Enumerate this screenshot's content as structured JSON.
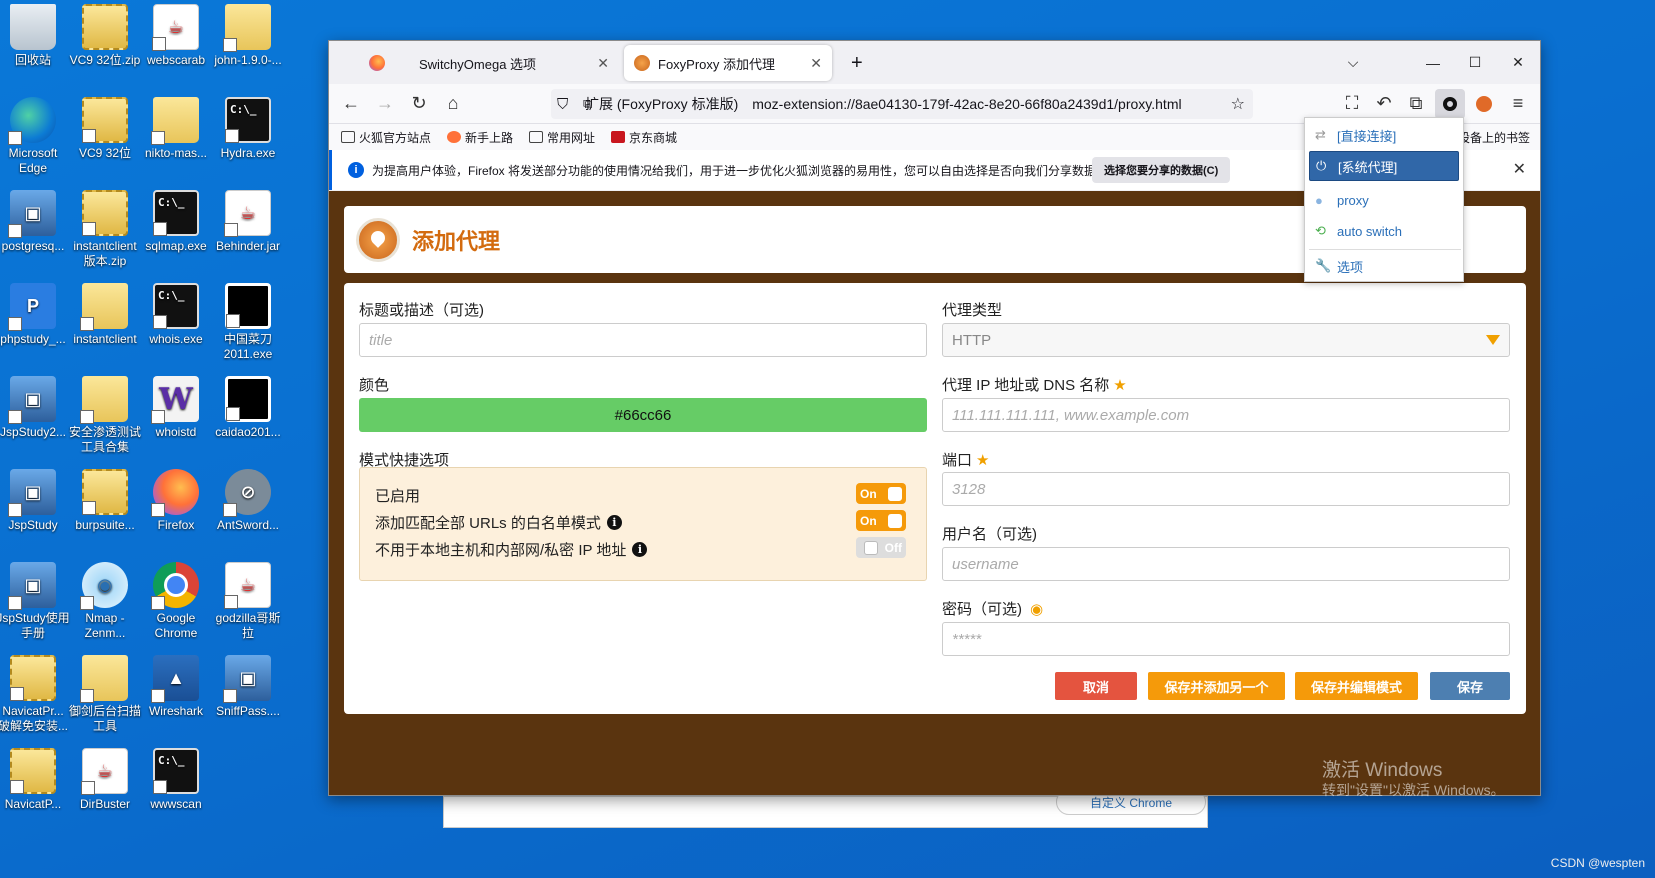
{
  "desktop": {
    "icons": [
      {
        "label": "回收站"
      },
      {
        "label": "VC9 32位.zip"
      },
      {
        "label": "webscarab"
      },
      {
        "label": "john-1.9.0-..."
      },
      {
        "label": "Microsoft Edge"
      },
      {
        "label": "VC9 32位"
      },
      {
        "label": "nikto-mas..."
      },
      {
        "label": "Hydra.exe"
      },
      {
        "label": "postgresq..."
      },
      {
        "label": "instantclient 版本.zip"
      },
      {
        "label": "sqlmap.exe"
      },
      {
        "label": "Behinder.jar"
      },
      {
        "label": "phpstudy_..."
      },
      {
        "label": "instantclient"
      },
      {
        "label": "whois.exe"
      },
      {
        "label": "中国菜刀2011.exe"
      },
      {
        "label": "JspStudy2..."
      },
      {
        "label": "安全渗透测试工具合集"
      },
      {
        "label": "whoistd"
      },
      {
        "label": "caidao201..."
      },
      {
        "label": "JspStudy"
      },
      {
        "label": "burpsuite..."
      },
      {
        "label": "Firefox"
      },
      {
        "label": "AntSword..."
      },
      {
        "label": "JspStudy使用手册"
      },
      {
        "label": "Nmap - Zenm..."
      },
      {
        "label": "Google Chrome"
      },
      {
        "label": "godzilla哥斯拉"
      },
      {
        "label": "NavicatPr... 破解免安装..."
      },
      {
        "label": "御剑后台扫描工具"
      },
      {
        "label": "Wireshark"
      },
      {
        "label": "SniffPass...."
      },
      {
        "label": "NavicatP..."
      },
      {
        "label": "DirBuster"
      },
      {
        "label": "wwwscan"
      }
    ],
    "watermark_line1": "激活 Windows",
    "watermark_line2": "转到\"设置\"以激活 Windows。",
    "csdn": "CSDN @wespten",
    "bg_window_button": "自定义 Chrome"
  },
  "browser": {
    "tabs": [
      {
        "label": "SwitchyOmega 选项"
      },
      {
        "label": "FoxyProxy 添加代理"
      }
    ],
    "new_tab": "+",
    "url_ext_label": "扩展 (FoxyProxy 标准版)",
    "url": "moz-extension://8ae04130-179f-42ac-8e20-66f80a2439d1/proxy.html",
    "bookmarks": [
      {
        "label": "火狐官方站点"
      },
      {
        "label": "新手上路"
      },
      {
        "label": "常用网址"
      },
      {
        "label": "京东商城"
      }
    ],
    "bookmarks_right": "设备上的书签",
    "notification": {
      "text": "为提高用户体验，Firefox 将发送部分功能的使用情况给我们，用于进一步优化火狐浏览器的易用性，您可以自由选择是否向我们分享数据。",
      "button": "选择您要分享的数据(C)"
    }
  },
  "foxyproxy": {
    "header_title": "添加代理",
    "title_label": "标题或描述（可选)",
    "title_placeholder": "title",
    "color_label": "颜色",
    "color_value": "#66cc66",
    "mode_label": "模式快捷选项",
    "mode_rows": [
      {
        "label": "已启用",
        "toggle": "On"
      },
      {
        "label": "添加匹配全部 URLs 的白名单模式",
        "toggle": "On"
      },
      {
        "label": "不用于本地主机和内部网/私密 IP 地址",
        "toggle": "Off"
      }
    ],
    "proxy_type_label": "代理类型",
    "proxy_type_value": "HTTP",
    "ip_label": "代理 IP 地址或 DNS 名称",
    "ip_placeholder": "111.111.111.111, www.example.com",
    "port_label": "端口",
    "port_placeholder": "3128",
    "user_label": "用户名（可选)",
    "user_placeholder": "username",
    "pass_label": "密码（可选)",
    "pass_placeholder": "*****",
    "buttons": {
      "cancel": "取消",
      "save_add": "保存并添加另一个",
      "save_edit": "保存并编辑模式",
      "save": "保存"
    },
    "brand_color": "#d36b0f",
    "bg_color": "#5a340f"
  },
  "switchy_menu": {
    "items": [
      {
        "label": "[直接连接]",
        "icon": "arrows-icon"
      },
      {
        "label": "[系统代理]",
        "icon": "power-icon",
        "selected": true
      },
      {
        "label": "proxy",
        "icon": "globe-icon"
      },
      {
        "label": "auto switch",
        "icon": "repeat-icon"
      },
      {
        "label": "选项",
        "icon": "wrench-icon"
      }
    ]
  }
}
